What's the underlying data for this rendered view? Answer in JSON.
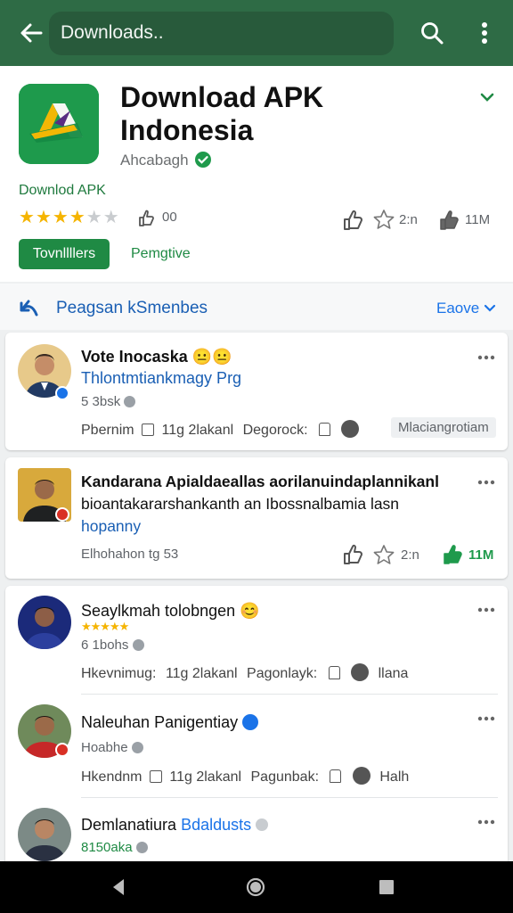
{
  "topbar": {
    "search_value": "Downloads.."
  },
  "app": {
    "title_line1": "Download APK",
    "title_line2": "Indonesia",
    "developer": "Ahcabagh",
    "subtitle": "Downlod APK",
    "rating_count": "00",
    "stat1": "2:n",
    "stat2": "11M",
    "install_label": "Tovnllllers",
    "secondary_label": "Pemgtive"
  },
  "reviews_header": {
    "title": "Peagsan kSmenbes",
    "sort_label": "Eaove"
  },
  "reviews": [
    {
      "name": "Vote Inocaska",
      "text": "Thlontmtiankmagy Prg",
      "meta": "5 3bsk",
      "action1": "Pbernim",
      "action2": "11g 2lakanl",
      "action3": "Degorock:",
      "chip": "Mlaciangrotiam"
    },
    {
      "name": "Kandarana Apialdaeallas aorilanuindaplannikanl",
      "text_line2": "bioantakararshankanth an Ibossnalbamia lasn",
      "link": "hopanny",
      "meta": "Elhohahon tg 53",
      "stat1": "2:n",
      "stat2": "11M"
    },
    {
      "name": "Seaylkmah tolobngen",
      "meta": "6 1bohs",
      "action1": "Hkevnimug:",
      "action2": "11g 2lakanl",
      "action3": "Pagonlayk:",
      "action4": "llana"
    },
    {
      "name": "Naleuhan Panigentiay",
      "meta": "Hoabhe",
      "action1": "Hkendnm",
      "action2": "11g 2lakanl",
      "action3": "Pagunbak:",
      "action4": "Halh"
    },
    {
      "name": "Demlanatiura",
      "tag": "Bdaldusts",
      "meta": "8150aka"
    }
  ],
  "colors": {
    "topbar": "#2e6b45",
    "brand_green": "#1f8a44",
    "link_blue": "#1a5fb4",
    "star": "#f5b400"
  },
  "icons": [
    "back-arrow-icon",
    "search-icon",
    "more-vert-icon",
    "verified-icon",
    "thumbs-up-icon",
    "star-outline-icon",
    "reply-icon",
    "share-icon",
    "back-nav-icon",
    "home-nav-icon",
    "recents-nav-icon"
  ]
}
